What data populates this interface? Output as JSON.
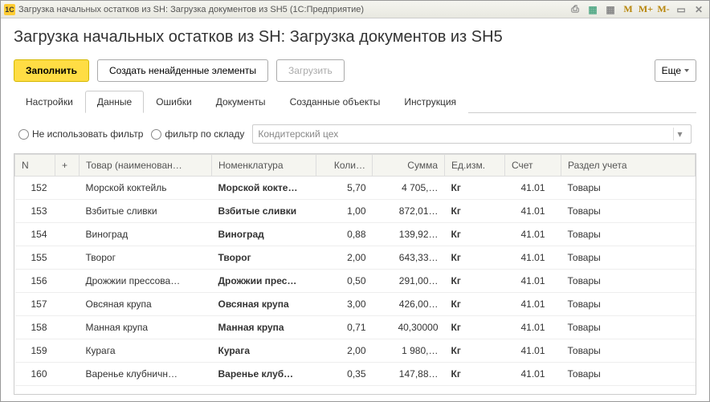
{
  "titlebar": {
    "app_label": "1С",
    "title": "Загрузка начальных остатков из SH: Загрузка документов из SH5  (1С:Предприятие)",
    "mem_m": "M",
    "mem_mplus": "M+",
    "mem_mminus": "M-"
  },
  "page": {
    "heading": "Загрузка начальных остатков из SH: Загрузка документов из SH5"
  },
  "toolbar": {
    "fill": "Заполнить",
    "create_missing": "Создать ненайденные элементы",
    "load": "Загрузить",
    "more": "Еще"
  },
  "tabs": [
    {
      "label": "Настройки"
    },
    {
      "label": "Данные",
      "active": true
    },
    {
      "label": "Ошибки"
    },
    {
      "label": "Документы"
    },
    {
      "label": "Созданные объекты"
    },
    {
      "label": "Инструкция"
    }
  ],
  "filter": {
    "no_filter_label": "Не использовать фильтр",
    "by_warehouse_label": "фильтр по складу",
    "warehouse_value": "Кондитерский цех"
  },
  "grid": {
    "columns": {
      "n": "N",
      "plus": "+",
      "name": "Товар (наименован…",
      "nom": "Номенклатура",
      "qty": "Коли…",
      "sum": "Сумма",
      "unit": "Ед.изм.",
      "acc": "Счет",
      "sec": "Раздел учета"
    },
    "rows": [
      {
        "n": "152",
        "name": "Морской коктейль",
        "nom": "Морской кокте…",
        "qty": "5,70",
        "sum": "4 705,…",
        "unit": "Кг",
        "acc": "41.01",
        "sec": "Товары"
      },
      {
        "n": "153",
        "name": "Взбитые сливки",
        "nom": "Взбитые сливки",
        "qty": "1,00",
        "sum": "872,01…",
        "unit": "Кг",
        "acc": "41.01",
        "sec": "Товары"
      },
      {
        "n": "154",
        "name": "Виноград",
        "nom": "Виноград",
        "qty": "0,88",
        "sum": "139,92…",
        "unit": "Кг",
        "acc": "41.01",
        "sec": "Товары"
      },
      {
        "n": "155",
        "name": "Творог",
        "nom": "Творог",
        "qty": "2,00",
        "sum": "643,33…",
        "unit": "Кг",
        "acc": "41.01",
        "sec": "Товары"
      },
      {
        "n": "156",
        "name": "Дрожжии прессова…",
        "nom": "Дрожжии прес…",
        "qty": "0,50",
        "sum": "291,00…",
        "unit": "Кг",
        "acc": "41.01",
        "sec": "Товары"
      },
      {
        "n": "157",
        "name": "Овсяная крупа",
        "nom": "Овсяная крупа",
        "qty": "3,00",
        "sum": "426,00…",
        "unit": "Кг",
        "acc": "41.01",
        "sec": "Товары"
      },
      {
        "n": "158",
        "name": "Манная крупа",
        "nom": "Манная крупа",
        "qty": "0,71",
        "sum": "40,30000",
        "unit": "Кг",
        "acc": "41.01",
        "sec": "Товары"
      },
      {
        "n": "159",
        "name": "Курага",
        "nom": "Курага",
        "qty": "2,00",
        "sum": "1 980,…",
        "unit": "Кг",
        "acc": "41.01",
        "sec": "Товары"
      },
      {
        "n": "160",
        "name": "Варенье клубничн…",
        "nom": "Варенье клуб…",
        "qty": "0,35",
        "sum": "147,88…",
        "unit": "Кг",
        "acc": "41.01",
        "sec": "Товары"
      }
    ]
  }
}
